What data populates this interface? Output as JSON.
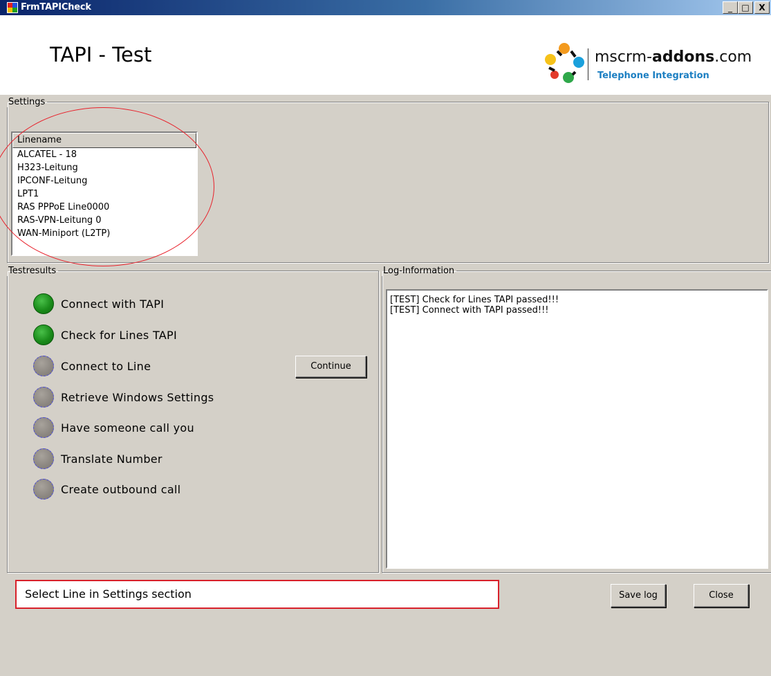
{
  "window": {
    "title": "FrmTAPICheck",
    "minimize_label": "_",
    "maximize_label": "□",
    "close_label": "X"
  },
  "header": {
    "title": "TAPI - Test",
    "logo_main_prefix": "mscrm-",
    "logo_main_bold": "addons",
    "logo_main_suffix": ".com",
    "logo_sub": "Telephone Integration"
  },
  "settings": {
    "legend": "Settings",
    "column_header": "Linename",
    "lines": [
      "ALCATEL - 18",
      "H323-Leitung",
      "IPCONF-Leitung",
      "LPT1",
      "RAS PPPoE Line0000",
      "RAS-VPN-Leitung 0",
      "WAN-Miniport (L2TP)"
    ]
  },
  "testresults": {
    "legend": "Testresults",
    "tests": [
      {
        "label": "Connect with TAPI",
        "status": "passed"
      },
      {
        "label": "Check for Lines TAPI",
        "status": "passed"
      },
      {
        "label": "Connect to Line",
        "status": "pending"
      },
      {
        "label": "Retrieve Windows Settings",
        "status": "pending"
      },
      {
        "label": "Have someone call you",
        "status": "pending"
      },
      {
        "label": "Translate Number",
        "status": "pending"
      },
      {
        "label": "Create outbound call",
        "status": "pending"
      }
    ],
    "continue_label": "Continue"
  },
  "log": {
    "legend": "Log-Information",
    "lines": [
      "[TEST] Check for Lines TAPI passed!!!",
      "[TEST] Connect with TAPI passed!!!"
    ]
  },
  "status": {
    "message": "Select Line in Settings section"
  },
  "buttons": {
    "save_log": "Save log",
    "close": "Close"
  },
  "colors": {
    "passed": "#1b8c1b",
    "pending": "#8c8781",
    "highlight": "#e8202a",
    "brand_blue": "#1c7fc2"
  }
}
